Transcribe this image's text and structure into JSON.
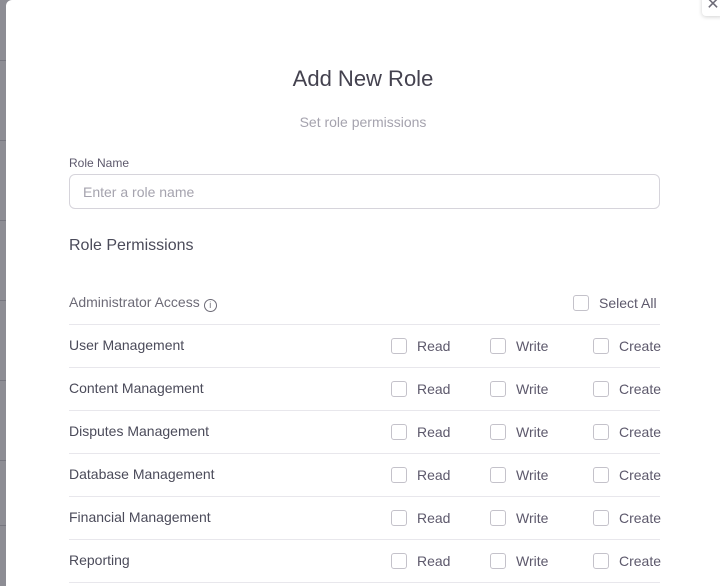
{
  "modal": {
    "title": "Add New Role",
    "subtitle": "Set role permissions",
    "close_icon": "close-icon"
  },
  "role_name": {
    "label": "Role Name",
    "placeholder": "Enter a role name",
    "value": ""
  },
  "permissions": {
    "section_title": "Role Permissions",
    "admin_label": "Administrator Access",
    "select_all_label": "Select All",
    "read_label": "Read",
    "write_label": "Write",
    "create_label": "Create",
    "rows": [
      {
        "name": "User Management"
      },
      {
        "name": "Content Management"
      },
      {
        "name": "Disputes Management"
      },
      {
        "name": "Database Management"
      },
      {
        "name": "Financial Management"
      },
      {
        "name": "Reporting"
      }
    ]
  }
}
